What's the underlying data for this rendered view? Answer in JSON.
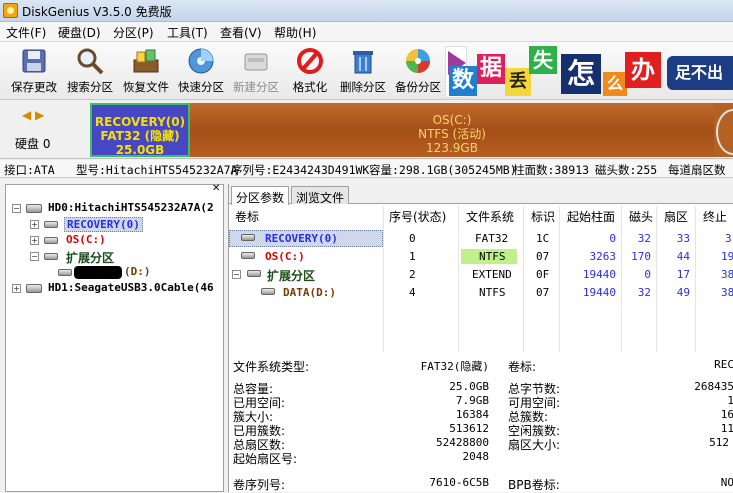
{
  "window": {
    "title": "DiskGenius V3.5.0 免费版"
  },
  "menu": [
    "文件(F)",
    "硬盘(D)",
    "分区(P)",
    "工具(T)",
    "查看(V)",
    "帮助(H)"
  ],
  "toolbar": {
    "buttons": [
      {
        "label": "保存更改",
        "icon": "save-icon",
        "enabled": true
      },
      {
        "label": "搜索分区",
        "icon": "magnifier-icon",
        "enabled": true
      },
      {
        "label": "恢复文件",
        "icon": "recover-files-icon",
        "enabled": true
      },
      {
        "label": "快速分区",
        "icon": "quick-partition-icon",
        "enabled": true
      },
      {
        "label": "新建分区",
        "icon": "new-partition-icon",
        "enabled": false
      },
      {
        "label": "格式化",
        "icon": "format-icon",
        "enabled": true
      },
      {
        "label": "删除分区",
        "icon": "trash-icon",
        "enabled": true
      },
      {
        "label": "备份分区",
        "icon": "backup-icon",
        "enabled": true
      }
    ],
    "banner": [
      "数",
      "据",
      "丢",
      "失",
      "怎",
      "么",
      "办",
      "足不出"
    ]
  },
  "disk_map": {
    "disk_label": "硬盘 0",
    "partitions": [
      {
        "name": "RECOVERY(0)",
        "fs": "FAT32 (隐藏)",
        "size": "25.0GB",
        "color": "#4747c4"
      },
      {
        "name": "OS(C:)",
        "fs": "NTFS (活动)",
        "size": "123.9GB",
        "color": "#b05a20"
      }
    ]
  },
  "disk_info": {
    "interface": "接口:ATA",
    "model": "型号:HitachiHTS545232A7A",
    "serial": "序列号:E2434243D491WK",
    "capacity": "容量:298.1GB(305245MB)",
    "cylinders": "柱面数:38913",
    "heads": "磁头数:255",
    "sectors": "每道扇区数"
  },
  "tree": {
    "nodes": [
      {
        "label": "HD0:HitachiHTS545232A7A(2"
      },
      {
        "label": "RECOVERY(0)"
      },
      {
        "label": "OS(C:)"
      },
      {
        "label": "扩展分区"
      },
      {
        "label": "(D:)"
      },
      {
        "label": "HD1:SeagateUSB3.0Cable(46"
      }
    ]
  },
  "tabs": [
    "分区参数",
    "浏览文件"
  ],
  "table": {
    "headers": [
      "卷标",
      "序号(状态)",
      "文件系统",
      "标识",
      "起始柱面",
      "磁头",
      "扇区",
      "终止"
    ],
    "rows": [
      {
        "label": "RECOVERY(0)",
        "index": "0",
        "fs": "FAT32",
        "id": "1C",
        "start_cyl": "0",
        "head": "32",
        "sector": "33",
        "end": "3"
      },
      {
        "label": "OS(C:)",
        "index": "1",
        "fs": "NTFS",
        "id": "07",
        "start_cyl": "3263",
        "head": "170",
        "sector": "44",
        "end": "19"
      },
      {
        "label": "扩展分区",
        "index": "2",
        "fs": "EXTEND",
        "id": "0F",
        "start_cyl": "19440",
        "head": "0",
        "sector": "17",
        "end": "38"
      },
      {
        "label": "DATA(D:)",
        "index": "4",
        "fs": "NTFS",
        "id": "07",
        "start_cyl": "19440",
        "head": "32",
        "sector": "49",
        "end": "38"
      }
    ]
  },
  "details": {
    "fs_type_label": "文件系统类型:",
    "fs_type_value": "FAT32(隐藏)",
    "volume_label": "卷标:",
    "volume_value": "REC",
    "left": [
      {
        "label": "总容量:",
        "value": "25.0GB"
      },
      {
        "label": "已用空间:",
        "value": "7.9GB"
      },
      {
        "label": "簇大小:",
        "value": "16384"
      },
      {
        "label": "已用簇数:",
        "value": "513612"
      },
      {
        "label": "总扇区数:",
        "value": "52428800"
      },
      {
        "label": "起始扇区号:",
        "value": "2048"
      }
    ],
    "right": [
      {
        "label": "总字节数:",
        "value": "268435"
      },
      {
        "label": "可用空间:",
        "value": "1"
      },
      {
        "label": "总簇数:",
        "value": "16"
      },
      {
        "label": "空闲簇数:",
        "value": "11"
      },
      {
        "label": "扇区大小:",
        "value": "512"
      }
    ],
    "serial_label": "卷序列号:",
    "serial_value": "7610-6C5B",
    "bpb_label": "BPB卷标:",
    "bpb_value": "NO"
  }
}
